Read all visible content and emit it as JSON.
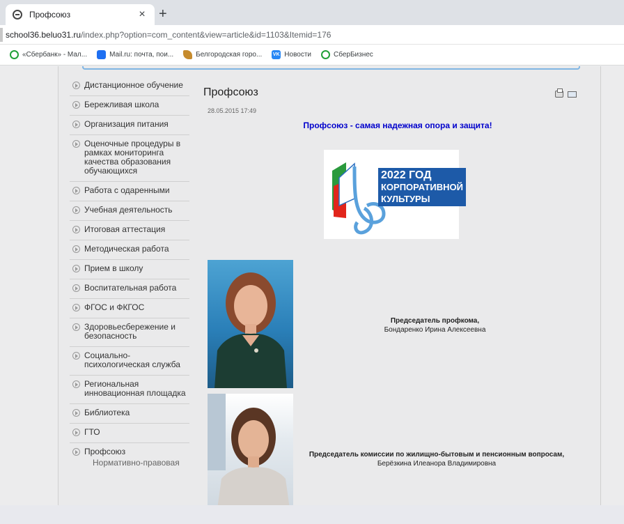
{
  "browser": {
    "tab_title": "Профсоюз",
    "tab_close": "×",
    "new_tab": "+",
    "url_host": "school36.beluo31.ru",
    "url_path": "/index.php?option=com_content&view=article&id=1103&Itemid=176",
    "bookmarks": [
      {
        "label": "«Сбербанк» - Мал...",
        "icon": "sberbank-icon"
      },
      {
        "label": "Mail.ru: почта, пои...",
        "icon": "mailru-icon"
      },
      {
        "label": "Белгородская горо...",
        "icon": "belgorod-icon"
      },
      {
        "label": "Новости",
        "icon": "vk-icon",
        "icon_text": "VK"
      },
      {
        "label": "СберБизнес",
        "icon": "sberbusiness-icon"
      }
    ]
  },
  "sidebar": {
    "items": [
      {
        "label": "Дистанционное обучение"
      },
      {
        "label": "Бережливая школа"
      },
      {
        "label": "Организация питания"
      },
      {
        "label": "Оценочные процедуры в рамках мониторинга качества образования обучающихся"
      },
      {
        "label": "Работа с одаренными"
      },
      {
        "label": "Учебная деятельность"
      },
      {
        "label": "Итоговая аттестация"
      },
      {
        "label": "Методическая работа"
      },
      {
        "label": "Прием в школу"
      },
      {
        "label": "Воспитательная работа"
      },
      {
        "label": "ФГОС и ФКГОС"
      },
      {
        "label": "Здоровьесбережение и безопасность"
      },
      {
        "label": "Социально-психологическая служба"
      },
      {
        "label": "Региональная инновационная площадка"
      },
      {
        "label": "Библиотека"
      },
      {
        "label": "ГТО"
      },
      {
        "label": "Профсоюз"
      }
    ],
    "subitem": "Нормативно-правовая"
  },
  "article": {
    "title": "Профсоюз",
    "date": "28.05.2015 17:49",
    "slogan": "Профсоюз - самая надежная опора и защита!",
    "logo_lines": [
      "2022 ГОД",
      "КОРПОРАТИВНОЙ",
      "КУЛЬТУРЫ"
    ],
    "person1": {
      "role": "Председатель профкома",
      "name": "Бондаренко Ирина Алексеевна"
    },
    "person2": {
      "role": "Председатель комиссии по жилищно-бытовым и пенсионным вопросам",
      "name": "Берёзкина Илеанора Владимировна"
    }
  },
  "colors": {
    "slogan": "#0000cc",
    "logo_blue": "#1d5aa8",
    "accent_strip": "#7fb5e3"
  }
}
